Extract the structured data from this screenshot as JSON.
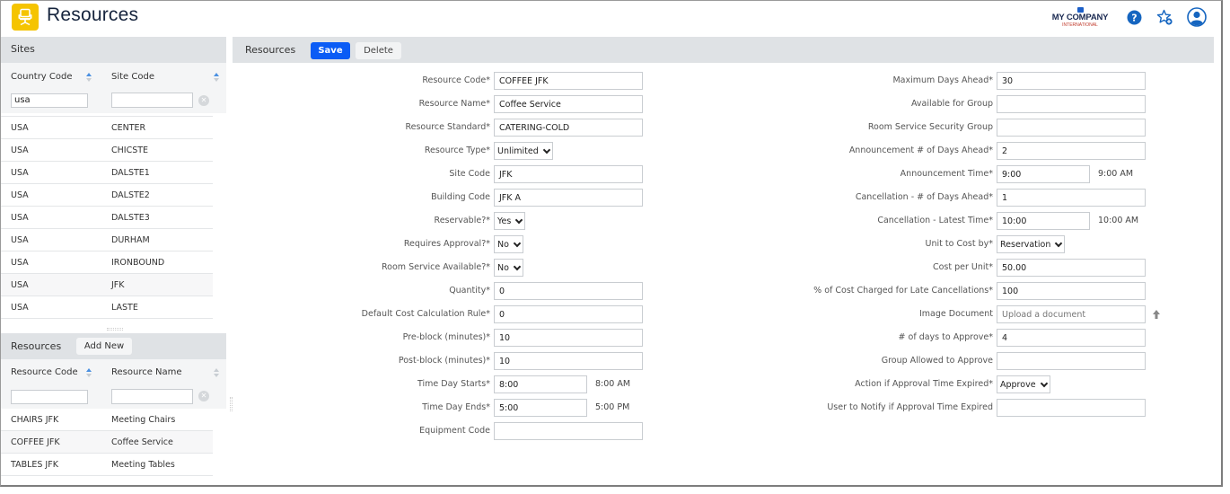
{
  "app": {
    "title": "Resources",
    "icon": "chair-icon"
  },
  "header": {
    "logo": {
      "name": "MY COMPANY",
      "sub": "INTERNATIONAL"
    },
    "icons": [
      "help-icon",
      "favorite-add-icon",
      "user-account-icon"
    ]
  },
  "sites": {
    "title": "Sites",
    "columns": [
      "Country Code",
      "Site Code"
    ],
    "filters": {
      "country_code": "usa",
      "site_code": ""
    },
    "rows": [
      {
        "country": "USA",
        "site": "CENTER"
      },
      {
        "country": "USA",
        "site": "CHICSTE"
      },
      {
        "country": "USA",
        "site": "DALSTE1"
      },
      {
        "country": "USA",
        "site": "DALSTE2"
      },
      {
        "country": "USA",
        "site": "DALSTE3"
      },
      {
        "country": "USA",
        "site": "DURHAM"
      },
      {
        "country": "USA",
        "site": "IRONBOUND"
      },
      {
        "country": "USA",
        "site": "JFK"
      },
      {
        "country": "USA",
        "site": "LASTE"
      }
    ]
  },
  "resources_list": {
    "title": "Resources",
    "add_new_label": "Add New",
    "columns": [
      "Resource Code",
      "Resource Name"
    ],
    "filters": {
      "resource_code": "",
      "resource_name": ""
    },
    "rows": [
      {
        "code": "CHAIRS JFK",
        "name": "Meeting Chairs"
      },
      {
        "code": "COFFEE JFK",
        "name": "Coffee Service"
      },
      {
        "code": "TABLES JFK",
        "name": "Meeting Tables"
      }
    ]
  },
  "toolbar": {
    "title": "Resources",
    "save_label": "Save",
    "delete_label": "Delete"
  },
  "form": {
    "left": [
      {
        "label": "Resource Code*",
        "type": "input",
        "value": "COFFEE JFK"
      },
      {
        "label": "Resource Name*",
        "type": "input",
        "value": "Coffee Service"
      },
      {
        "label": "Resource Standard*",
        "type": "input",
        "value": "CATERING-COLD"
      },
      {
        "label": "Resource Type*",
        "type": "select",
        "value": "Unlimited"
      },
      {
        "label": "Site Code",
        "type": "input",
        "value": "JFK"
      },
      {
        "label": "Building Code",
        "type": "input",
        "value": "JFK A"
      },
      {
        "label": "Reservable?*",
        "type": "select",
        "value": "Yes"
      },
      {
        "label": "Requires Approval?*",
        "type": "select",
        "value": "No"
      },
      {
        "label": "Room Service Available?*",
        "type": "select",
        "value": "No"
      },
      {
        "label": "Quantity*",
        "type": "input",
        "value": "0"
      },
      {
        "label": "Default Cost Calculation Rule*",
        "type": "input",
        "value": "0"
      },
      {
        "label": "Pre-block (minutes)*",
        "type": "input",
        "value": "10"
      },
      {
        "label": "Post-block (minutes)*",
        "type": "input",
        "value": "10"
      },
      {
        "label": "Time Day Starts*",
        "type": "time",
        "value": "8:00",
        "note": "8:00 AM"
      },
      {
        "label": "Time Day Ends*",
        "type": "time",
        "value": "5:00",
        "note": "5:00 PM"
      },
      {
        "label": "Equipment Code",
        "type": "input",
        "value": ""
      }
    ],
    "right": [
      {
        "label": "Maximum Days Ahead*",
        "type": "input",
        "value": "30"
      },
      {
        "label": "Available for Group",
        "type": "input",
        "value": ""
      },
      {
        "label": "Room Service Security Group",
        "type": "input",
        "value": ""
      },
      {
        "label": "Announcement # of Days Ahead*",
        "type": "input",
        "value": "2"
      },
      {
        "label": "Announcement Time*",
        "type": "time",
        "value": "9:00",
        "note": "9:00 AM"
      },
      {
        "label": "Cancellation - # of Days Ahead*",
        "type": "input",
        "value": "1"
      },
      {
        "label": "Cancellation - Latest Time*",
        "type": "time",
        "value": "10:00",
        "note": "10:00 AM"
      },
      {
        "label": "Unit to Cost by*",
        "type": "select",
        "value": "Reservation"
      },
      {
        "label": "Cost per Unit*",
        "type": "input",
        "value": "50.00"
      },
      {
        "label": "% of Cost Charged for Late Cancellations*",
        "type": "input",
        "value": "100"
      },
      {
        "label": "Image Document",
        "type": "upload",
        "value": "",
        "placeholder": "Upload a document"
      },
      {
        "label": "# of days to Approve*",
        "type": "input",
        "value": "4"
      },
      {
        "label": "Group Allowed to Approve",
        "type": "input",
        "value": ""
      },
      {
        "label": "Action if Approval Time Expired*",
        "type": "select",
        "value": "Approve"
      },
      {
        "label": "User to Notify if Approval Time Expired",
        "type": "input",
        "value": ""
      }
    ]
  },
  "colors": {
    "accent": "#0b5cf5",
    "app_icon_bg": "#f5c400",
    "bar_bg": "#dfe2e5",
    "help_icon": "#1565c0"
  }
}
